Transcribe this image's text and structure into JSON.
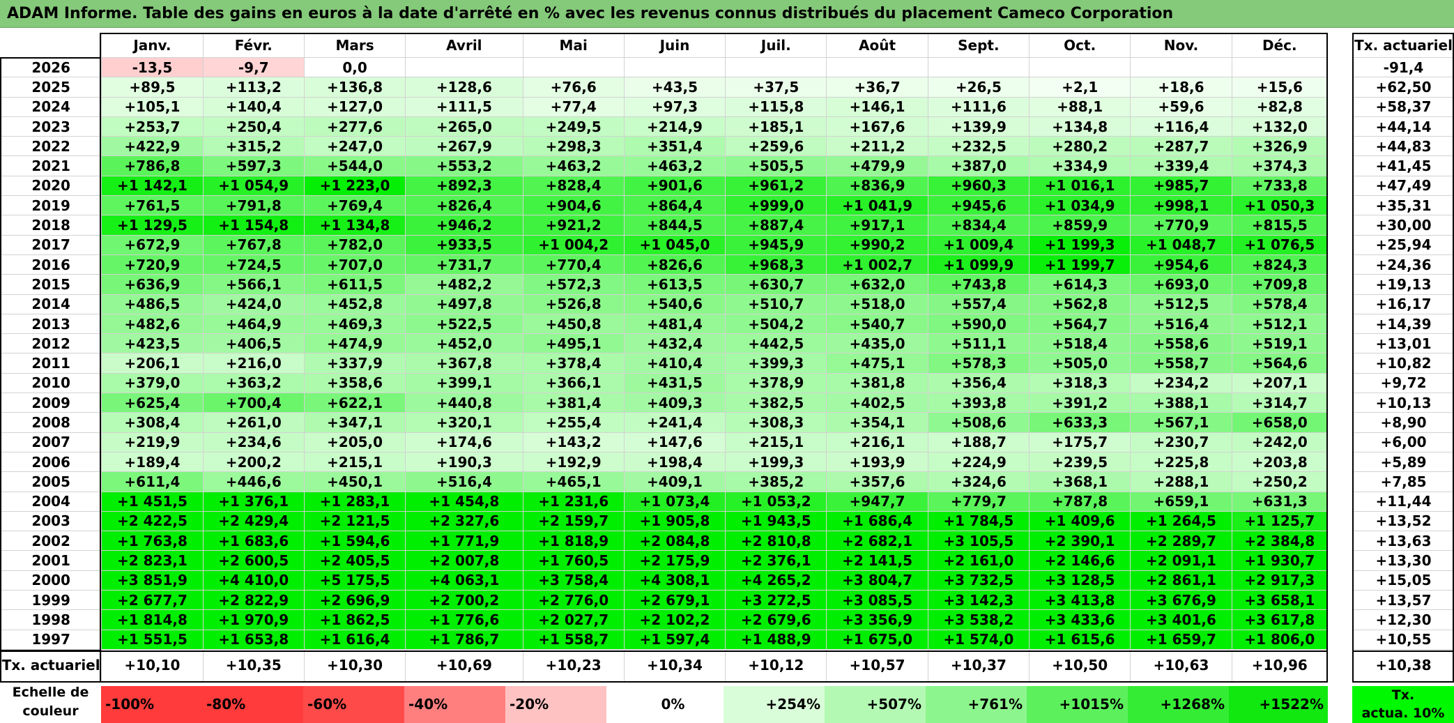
{
  "title": "ADAM Informe. Table des gains en euros à la date d'arrêté en % avec les revenus connus distribués du placement Cameco Corporation",
  "months": [
    "Janv.",
    "Févr.",
    "Mars",
    "Avril",
    "Mai",
    "Juin",
    "Juil.",
    "Août",
    "Sept.",
    "Oct.",
    "Nov.",
    "Déc."
  ],
  "rate_header": "Tx. actuariel",
  "rows": [
    {
      "year": "2026",
      "v": [
        "-13,5",
        "-9,7",
        "0,0",
        "",
        "",
        "",
        "",
        "",
        "",
        "",
        "",
        ""
      ],
      "rate": "-91,4"
    },
    {
      "year": "2025",
      "v": [
        "+89,5",
        "+113,2",
        "+136,8",
        "+128,6",
        "+76,6",
        "+43,5",
        "+37,5",
        "+36,7",
        "+26,5",
        "+2,1",
        "+18,6",
        "+15,6"
      ],
      "rate": "+62,50"
    },
    {
      "year": "2024",
      "v": [
        "+105,1",
        "+140,4",
        "+127,0",
        "+111,5",
        "+77,4",
        "+97,3",
        "+115,8",
        "+146,1",
        "+111,6",
        "+88,1",
        "+59,6",
        "+82,8"
      ],
      "rate": "+58,37"
    },
    {
      "year": "2023",
      "v": [
        "+253,7",
        "+250,4",
        "+277,6",
        "+265,0",
        "+249,5",
        "+214,9",
        "+185,1",
        "+167,6",
        "+139,9",
        "+134,8",
        "+116,4",
        "+132,0"
      ],
      "rate": "+44,14"
    },
    {
      "year": "2022",
      "v": [
        "+422,9",
        "+315,2",
        "+247,0",
        "+267,9",
        "+298,3",
        "+351,4",
        "+259,6",
        "+211,2",
        "+232,5",
        "+280,2",
        "+287,7",
        "+326,9"
      ],
      "rate": "+44,83"
    },
    {
      "year": "2021",
      "v": [
        "+786,8",
        "+597,3",
        "+544,0",
        "+553,2",
        "+463,2",
        "+463,2",
        "+505,5",
        "+479,9",
        "+387,0",
        "+334,9",
        "+339,4",
        "+374,3"
      ],
      "rate": "+41,45"
    },
    {
      "year": "2020",
      "v": [
        "+1 142,1",
        "+1 054,9",
        "+1 223,0",
        "+892,3",
        "+828,4",
        "+901,6",
        "+961,2",
        "+836,9",
        "+960,3",
        "+1 016,1",
        "+985,7",
        "+733,8"
      ],
      "rate": "+47,49"
    },
    {
      "year": "2019",
      "v": [
        "+761,5",
        "+791,8",
        "+769,4",
        "+826,4",
        "+904,6",
        "+864,4",
        "+999,0",
        "+1 041,9",
        "+945,6",
        "+1 034,9",
        "+998,1",
        "+1 050,3"
      ],
      "rate": "+35,31"
    },
    {
      "year": "2018",
      "v": [
        "+1 129,5",
        "+1 154,8",
        "+1 134,8",
        "+946,2",
        "+921,2",
        "+844,5",
        "+887,4",
        "+917,1",
        "+834,4",
        "+859,9",
        "+770,9",
        "+815,5"
      ],
      "rate": "+30,00"
    },
    {
      "year": "2017",
      "v": [
        "+672,9",
        "+767,8",
        "+782,0",
        "+933,5",
        "+1 004,2",
        "+1 045,0",
        "+945,9",
        "+990,2",
        "+1 009,4",
        "+1 199,3",
        "+1 048,7",
        "+1 076,5"
      ],
      "rate": "+25,94"
    },
    {
      "year": "2016",
      "v": [
        "+720,9",
        "+724,5",
        "+707,0",
        "+731,7",
        "+770,4",
        "+826,6",
        "+968,3",
        "+1 002,7",
        "+1 099,9",
        "+1 199,7",
        "+954,6",
        "+824,3"
      ],
      "rate": "+24,36"
    },
    {
      "year": "2015",
      "v": [
        "+636,9",
        "+566,1",
        "+611,5",
        "+482,2",
        "+572,3",
        "+613,5",
        "+630,7",
        "+632,0",
        "+743,8",
        "+614,3",
        "+693,0",
        "+709,8"
      ],
      "rate": "+19,13"
    },
    {
      "year": "2014",
      "v": [
        "+486,5",
        "+424,0",
        "+452,8",
        "+497,8",
        "+526,8",
        "+540,6",
        "+510,7",
        "+518,0",
        "+557,4",
        "+562,8",
        "+512,5",
        "+578,4"
      ],
      "rate": "+16,17"
    },
    {
      "year": "2013",
      "v": [
        "+482,6",
        "+464,9",
        "+469,3",
        "+522,5",
        "+450,8",
        "+481,4",
        "+504,2",
        "+540,7",
        "+590,0",
        "+564,7",
        "+516,4",
        "+512,1"
      ],
      "rate": "+14,39"
    },
    {
      "year": "2012",
      "v": [
        "+423,5",
        "+406,5",
        "+474,9",
        "+452,0",
        "+495,1",
        "+432,4",
        "+442,5",
        "+435,0",
        "+511,1",
        "+518,4",
        "+558,6",
        "+519,1"
      ],
      "rate": "+13,01"
    },
    {
      "year": "2011",
      "v": [
        "+206,1",
        "+216,0",
        "+337,9",
        "+367,8",
        "+378,4",
        "+410,4",
        "+399,3",
        "+475,1",
        "+578,3",
        "+505,0",
        "+558,7",
        "+564,6"
      ],
      "rate": "+10,82"
    },
    {
      "year": "2010",
      "v": [
        "+379,0",
        "+363,2",
        "+358,6",
        "+399,1",
        "+366,1",
        "+431,5",
        "+378,9",
        "+381,8",
        "+356,4",
        "+318,3",
        "+234,2",
        "+207,1"
      ],
      "rate": "+9,72"
    },
    {
      "year": "2009",
      "v": [
        "+625,4",
        "+700,4",
        "+622,1",
        "+440,8",
        "+381,4",
        "+409,3",
        "+382,5",
        "+402,5",
        "+393,8",
        "+391,2",
        "+388,1",
        "+314,7"
      ],
      "rate": "+10,13"
    },
    {
      "year": "2008",
      "v": [
        "+308,4",
        "+261,0",
        "+347,1",
        "+320,1",
        "+255,4",
        "+241,4",
        "+308,3",
        "+354,1",
        "+508,6",
        "+633,3",
        "+567,1",
        "+658,0"
      ],
      "rate": "+8,90"
    },
    {
      "year": "2007",
      "v": [
        "+219,9",
        "+234,6",
        "+205,0",
        "+174,6",
        "+143,2",
        "+147,6",
        "+215,1",
        "+216,1",
        "+188,7",
        "+175,7",
        "+230,7",
        "+242,0"
      ],
      "rate": "+6,00"
    },
    {
      "year": "2006",
      "v": [
        "+189,4",
        "+200,2",
        "+215,1",
        "+190,3",
        "+192,9",
        "+198,4",
        "+199,3",
        "+193,9",
        "+224,9",
        "+239,5",
        "+225,8",
        "+203,8"
      ],
      "rate": "+5,89"
    },
    {
      "year": "2005",
      "v": [
        "+611,4",
        "+446,6",
        "+450,1",
        "+516,4",
        "+465,1",
        "+409,1",
        "+385,2",
        "+357,6",
        "+324,6",
        "+368,1",
        "+288,1",
        "+250,2"
      ],
      "rate": "+7,85"
    },
    {
      "year": "2004",
      "v": [
        "+1 451,5",
        "+1 376,1",
        "+1 283,1",
        "+1 454,8",
        "+1 231,6",
        "+1 073,4",
        "+1 053,2",
        "+947,7",
        "+779,7",
        "+787,8",
        "+659,1",
        "+631,3"
      ],
      "rate": "+11,44"
    },
    {
      "year": "2003",
      "v": [
        "+2 422,5",
        "+2 429,4",
        "+2 121,5",
        "+2 327,6",
        "+2 159,7",
        "+1 905,8",
        "+1 943,5",
        "+1 686,4",
        "+1 784,5",
        "+1 409,6",
        "+1 264,5",
        "+1 125,7"
      ],
      "rate": "+13,52"
    },
    {
      "year": "2002",
      "v": [
        "+1 763,8",
        "+1 683,6",
        "+1 594,6",
        "+1 771,9",
        "+1 818,9",
        "+2 084,8",
        "+2 810,8",
        "+2 682,1",
        "+3 105,5",
        "+2 390,1",
        "+2 289,7",
        "+2 384,8"
      ],
      "rate": "+13,63"
    },
    {
      "year": "2001",
      "v": [
        "+2 823,1",
        "+2 600,5",
        "+2 405,5",
        "+2 007,8",
        "+1 760,5",
        "+2 175,9",
        "+2 376,1",
        "+2 141,5",
        "+2 161,0",
        "+2 146,6",
        "+2 091,1",
        "+1 930,7"
      ],
      "rate": "+13,30"
    },
    {
      "year": "2000",
      "v": [
        "+3 851,9",
        "+4 410,0",
        "+5 175,5",
        "+4 063,1",
        "+3 758,4",
        "+4 308,1",
        "+4 265,2",
        "+3 804,7",
        "+3 732,5",
        "+3 128,5",
        "+2 861,1",
        "+2 917,3"
      ],
      "rate": "+15,05"
    },
    {
      "year": "1999",
      "v": [
        "+2 677,7",
        "+2 822,9",
        "+2 696,9",
        "+2 700,2",
        "+2 776,0",
        "+2 679,1",
        "+3 272,5",
        "+3 085,5",
        "+3 142,3",
        "+3 413,8",
        "+3 676,9",
        "+3 658,1"
      ],
      "rate": "+13,57"
    },
    {
      "year": "1998",
      "v": [
        "+1 814,8",
        "+1 970,9",
        "+1 862,5",
        "+1 776,6",
        "+2 027,7",
        "+2 102,2",
        "+2 679,6",
        "+3 356,9",
        "+3 538,2",
        "+3 433,6",
        "+3 401,6",
        "+3 617,8"
      ],
      "rate": "+12,30"
    },
    {
      "year": "1997",
      "v": [
        "+1 551,5",
        "+1 653,8",
        "+1 616,4",
        "+1 786,7",
        "+1 558,7",
        "+1 597,4",
        "+1 488,9",
        "+1 675,0",
        "+1 574,0",
        "+1 615,6",
        "+1 659,7",
        "+1 806,0"
      ],
      "rate": "+10,55"
    }
  ],
  "footer": {
    "label": "Tx. actuariel",
    "values": [
      "+10,10",
      "+10,35",
      "+10,30",
      "+10,69",
      "+10,23",
      "+10,34",
      "+10,12",
      "+10,57",
      "+10,37",
      "+10,50",
      "+10,63",
      "+10,96"
    ],
    "rate": "+10,38"
  },
  "scale": {
    "label_line1": "Echelle de",
    "label_line2": "couleur",
    "items": [
      {
        "label": "-100%",
        "color": "#ff3b3b",
        "align": "left"
      },
      {
        "label": "-80%",
        "color": "#ff3b3b",
        "align": "left"
      },
      {
        "label": "-60%",
        "color": "#ff4a4a",
        "align": "left"
      },
      {
        "label": "-40%",
        "color": "#ff7f7f",
        "align": "left"
      },
      {
        "label": "-20%",
        "color": "#ffc2c2",
        "align": "left"
      },
      {
        "label": "0%",
        "color": "#ffffff",
        "align": "center"
      },
      {
        "label": "+254%",
        "color": "#d9fdd9",
        "align": "right"
      },
      {
        "label": "+507%",
        "color": "#b3f9b3",
        "align": "right"
      },
      {
        "label": "+761%",
        "color": "#8df58d",
        "align": "right"
      },
      {
        "label": "+1015%",
        "color": "#5cf05c",
        "align": "right"
      },
      {
        "label": "+1268%",
        "color": "#35ec35",
        "align": "right"
      },
      {
        "label": "+1522%",
        "color": "#10e810",
        "align": "right"
      }
    ],
    "rate_label_line1": "Tx.",
    "rate_label_line2": "actua. 10%",
    "rate_color": "#00f800"
  },
  "colors": {
    "title_bg": "#85c97a",
    "negative_light": "#ffd6d6",
    "positive_max": "#00f000"
  }
}
